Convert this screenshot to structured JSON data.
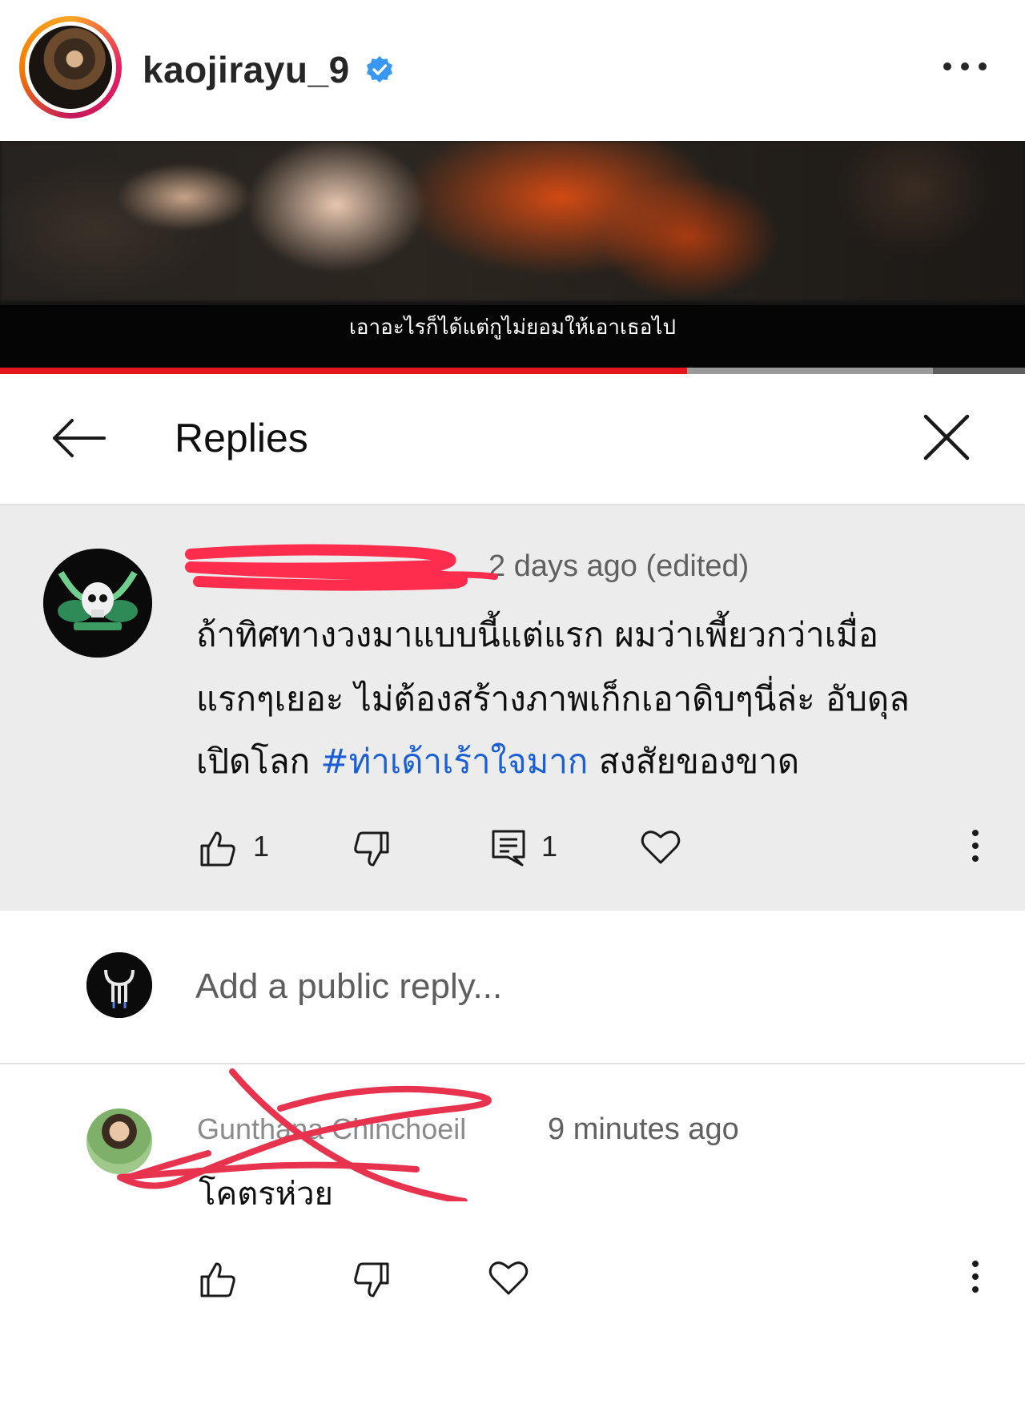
{
  "instagram": {
    "username": "kaojirayu_9",
    "verified_icon": "verified-badge-icon",
    "more_icon": "more-horizontal-icon"
  },
  "video": {
    "subtitle": "เอาอะไรก็ได้แต่กูไม่ยอมให้เอาเธอไป",
    "progress_played": 0.67,
    "progress_buffered": 0.91,
    "colors": {
      "played": "#e3161b",
      "buffered": "#9a9a9a"
    }
  },
  "replies_panel": {
    "title": "Replies",
    "back_icon": "back-arrow-icon",
    "close_icon": "close-icon"
  },
  "main_comment": {
    "time": "2 days ago (edited)",
    "text_line1": "ถ้าทิศทางวงมาแบบนี้แต่แรก ผมว่าเพี้ยวกว่าเมื่อ",
    "text_line2": "แรกๆเยอะ ไม่ต้องสร้างภาพเก็กเอาดิบๆนี่ล่ะ อับดุล",
    "text_line3_before": "เปิดโลก ",
    "hashtag": "#ท่าเด้าเร้าใจมาก",
    "text_line3_after": " สงสัยของขาด",
    "likes": "1",
    "replies": "1",
    "hashtag_color": "#1b5fd8",
    "background": "#ececec"
  },
  "reply_box": {
    "placeholder": "Add a public reply..."
  },
  "reply": {
    "author": "Gunthana Chinchoeil",
    "time": "9 minutes ago",
    "text": "โคตรห่วย"
  },
  "annotation_color": "#e8334f"
}
